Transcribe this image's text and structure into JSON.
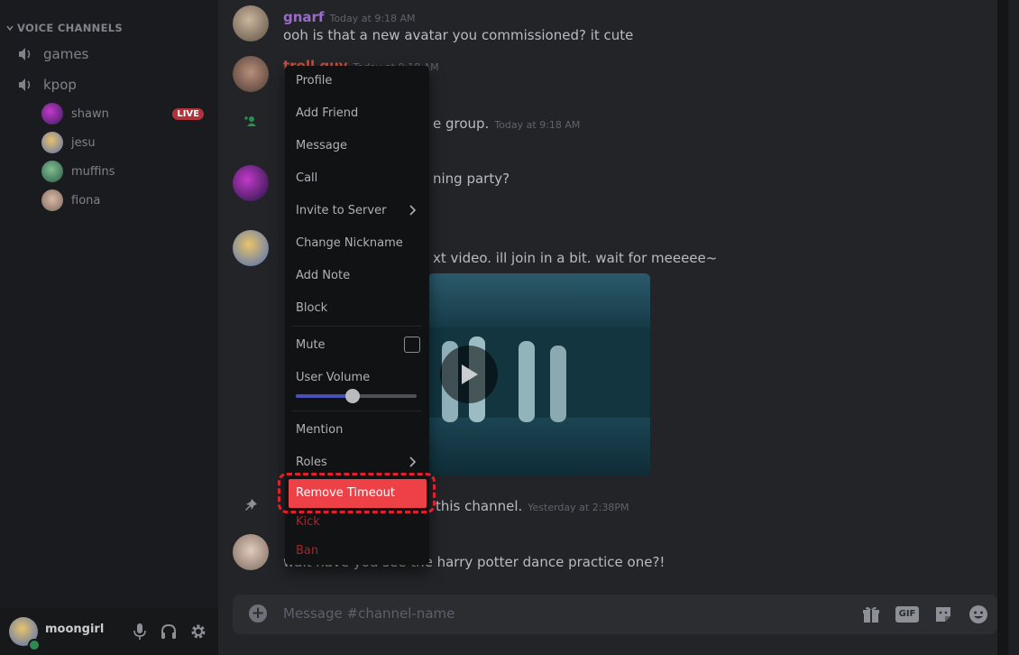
{
  "sidebar": {
    "section_title": "VOICE CHANNELS",
    "channels": [
      {
        "name": "games"
      },
      {
        "name": "kpop"
      }
    ],
    "voice_users": [
      {
        "name": "shawn",
        "badge": "LIVE"
      },
      {
        "name": "jesu"
      },
      {
        "name": "muffins"
      },
      {
        "name": "fiona"
      }
    ]
  },
  "user_panel": {
    "username": "moongirl"
  },
  "messages": [
    {
      "author": "gnarf",
      "timestamp": "Today at 9:18 AM",
      "text": "ooh is that a new avatar you commissioned? it cute"
    },
    {
      "author": "troll guy",
      "timestamp": "Today at 9:18 AM"
    },
    {
      "system_text": "e group.",
      "timestamp": "Today at 9:18 AM"
    },
    {
      "text": "ning party?"
    },
    {
      "text": "xt video. ill join in a bit. wait for meeeee~"
    },
    {
      "system_text": "this channel.",
      "timestamp": "Yesterday at 2:38PM"
    },
    {
      "text": "wait have you see the harry potter dance practice one?!"
    }
  ],
  "composer": {
    "placeholder": "Message #channel-name",
    "gif_label": "GIF"
  },
  "context_menu": {
    "items": [
      "Profile",
      "Add Friend",
      "Message",
      "Call",
      "Invite to Server",
      "Change Nickname",
      "Add Note",
      "Block"
    ],
    "mute": "Mute",
    "user_volume": "User Volume",
    "volume_level": 0.47,
    "mention": "Mention",
    "roles": "Roles",
    "remove_timeout": "Remove Timeout",
    "kick": "Kick",
    "ban": "Ban"
  },
  "colors": {
    "accent": "#ee4147",
    "username_gnarf": "#9b6bc8",
    "username_troll": "#c0513d",
    "live": "#b0323a"
  }
}
